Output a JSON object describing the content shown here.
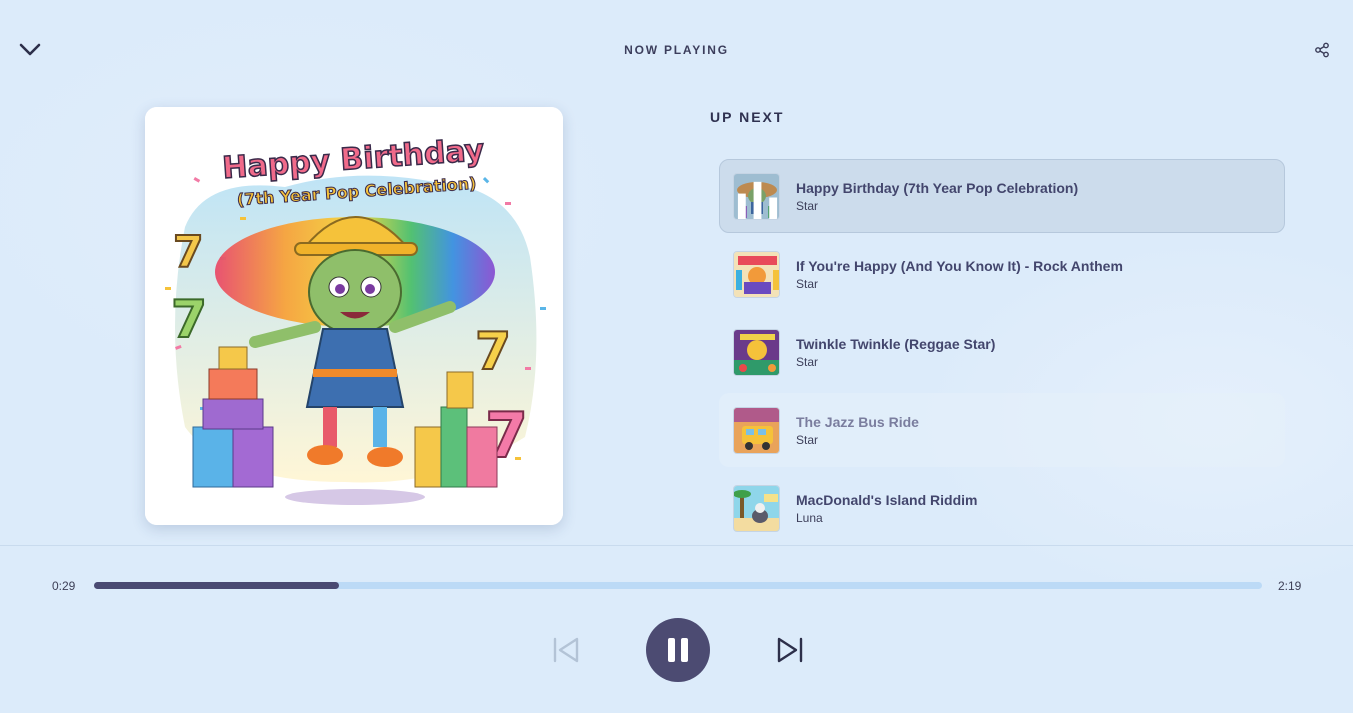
{
  "header": {
    "title": "NOW PLAYING"
  },
  "album_art": {
    "headline": "Happy Birthday",
    "subline": "(7th Year Pop Celebration)"
  },
  "queue": {
    "title": "UP NEXT",
    "tracks": [
      {
        "title": "Happy Birthday (7th Year Pop Celebration)",
        "artist": "Star",
        "state": "playing"
      },
      {
        "title": "If You're Happy (And You Know It) - Rock Anthem",
        "artist": "Star",
        "state": "normal"
      },
      {
        "title": "Twinkle Twinkle (Reggae Star)",
        "artist": "Star",
        "state": "normal"
      },
      {
        "title": "The Jazz Bus Ride",
        "artist": "Star",
        "state": "hover"
      },
      {
        "title": "MacDonald's Island Riddim",
        "artist": "Luna",
        "state": "normal"
      }
    ]
  },
  "player": {
    "current_time": "0:29",
    "total_time": "2:19",
    "progress_fraction": 0.21,
    "is_playing": true
  },
  "colors": {
    "background": "#dcebfa",
    "accent": "#4c4b72",
    "progress_track": "#bcdaf6",
    "active_row": "#ccdcec"
  },
  "icons": {
    "collapse": "chevron-down-icon",
    "share": "share-icon",
    "previous": "skip-previous-icon",
    "pause": "pause-icon",
    "next": "skip-next-icon",
    "now_playing_indicator": "equalizer-icon"
  }
}
